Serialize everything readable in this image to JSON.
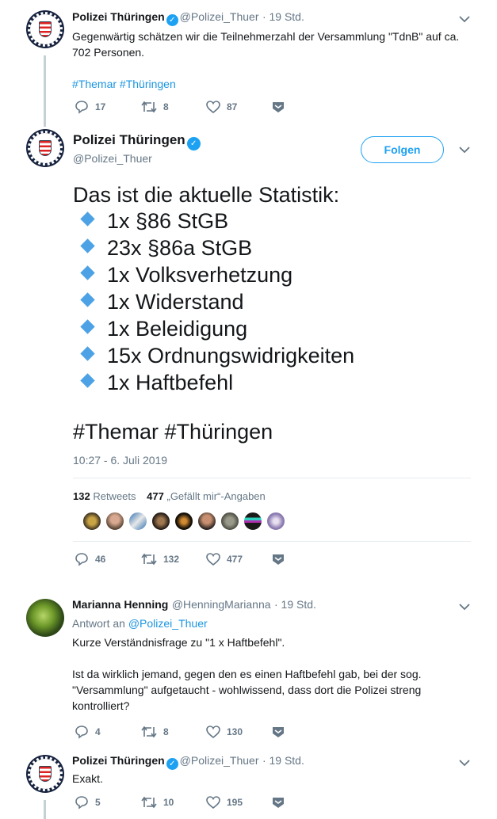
{
  "tweets": [
    {
      "name": "Polizei Thüringen",
      "handle": "@Polizei_Thuer",
      "time": "· 19 Std.",
      "text_line1": "Gegenwärtig schätzen wir die Teilnehmerzahl der Versammlung \"TdnB\" auf ca.",
      "text_line2": "702 Personen.",
      "hashtags": "#Themar #Thüringen",
      "replies": "17",
      "retweets": "8",
      "likes": "87"
    }
  ],
  "main": {
    "name": "Polizei Thüringen",
    "handle": "@Polizei_Thuer",
    "follow_label": "Folgen",
    "intro": "Das ist die aktuelle Statistik:",
    "stats": [
      "1x §86 StGB",
      "23x §86a StGB",
      "1x Volksverhetzung",
      "1x Widerstand",
      "1x Beleidigung",
      "15x Ordnungswidrigkeiten",
      "1x Haftbefehl"
    ],
    "hashtags": "#Themar #Thüringen",
    "timestamp": "10:27 - 6. Juli 2019",
    "retweet_count": "132",
    "retweet_label": "Retweets",
    "like_count": "477",
    "like_label": "„Gefällt mir“-Angaben",
    "replies": "46",
    "retweets": "132",
    "likes": "477"
  },
  "reply": {
    "name": "Marianna Henning",
    "handle": "@HenningMarianna",
    "time": "· 19 Std.",
    "reply_to_prefix": "Antwort an",
    "reply_to_handle": "@Polizei_Thuer",
    "line1": "Kurze Verständnisfrage zu \"1 x Haftbefehl\".",
    "line2": "Ist da wirklich jemand, gegen den es einen Haftbefehl gab, bei der sog.",
    "line3": "\"Versammlung\" aufgetaucht - wohlwissend, dass dort die Polizei streng",
    "line4": "kontrolliert?",
    "replies": "4",
    "retweets": "8",
    "likes": "130"
  },
  "last": {
    "name": "Polizei Thüringen",
    "handle": "@Polizei_Thuer",
    "time": "· 19 Std.",
    "text": "Exakt.",
    "replies": "5",
    "retweets": "10",
    "likes": "195"
  },
  "colors": {
    "accent": "#1da1f2",
    "hashtag": "#1b95e0",
    "muted": "#657786",
    "diamond": "#4da2e6"
  }
}
